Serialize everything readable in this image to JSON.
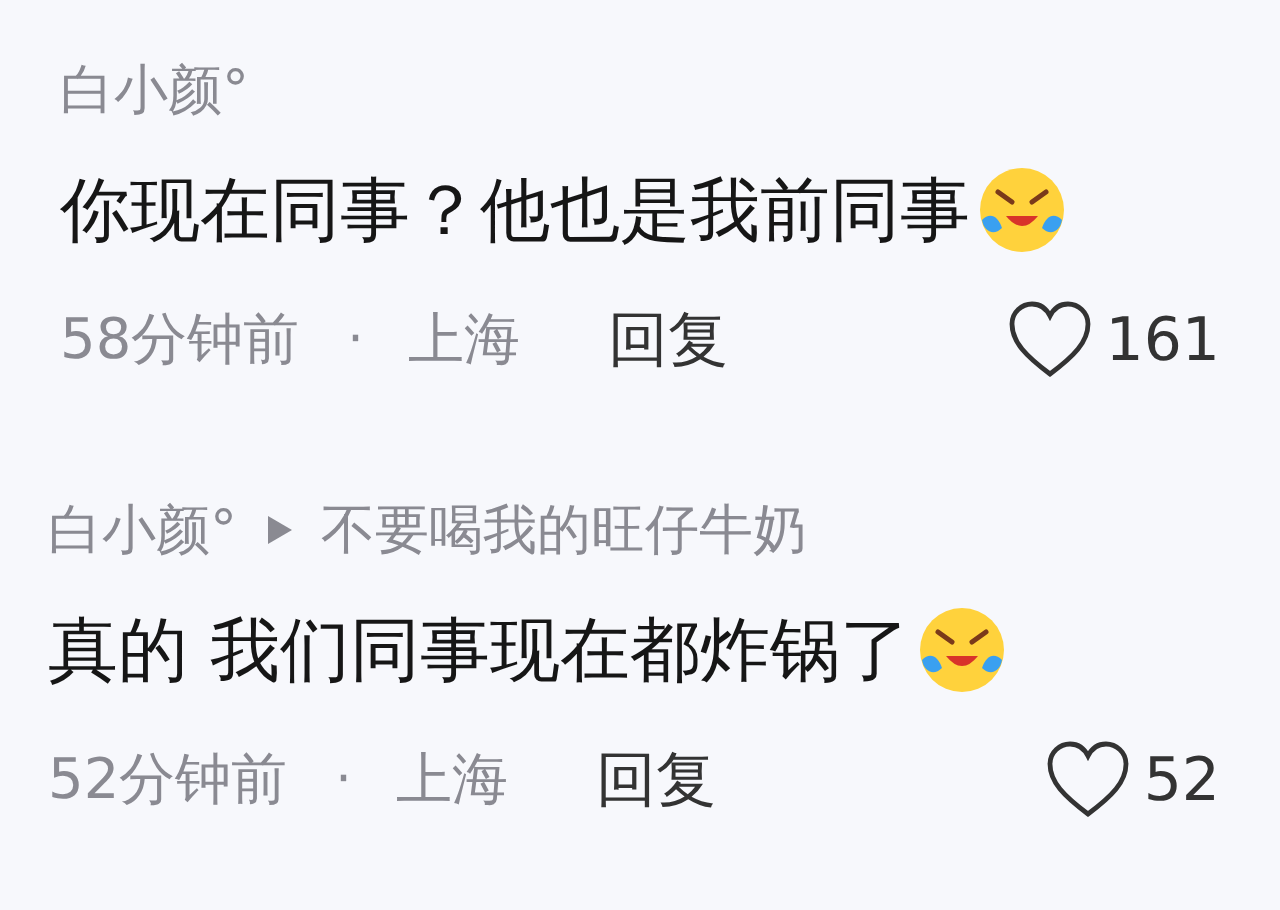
{
  "comments": [
    {
      "author": "白小颜°",
      "text": "你现在同事？他也是我前同事",
      "emoji": true,
      "time": "58分钟前",
      "separator": "·",
      "location": "上海",
      "reply_label": "回复",
      "liked": false,
      "likes": "161"
    },
    {
      "author": "白小颜°",
      "reply_to": "不要喝我的旺仔牛奶",
      "text": "真的 我们同事现在都炸锅了",
      "emoji": true,
      "time": "52分钟前",
      "separator": "·",
      "location": "上海",
      "reply_label": "回复",
      "liked": false,
      "likes": "52"
    }
  ]
}
